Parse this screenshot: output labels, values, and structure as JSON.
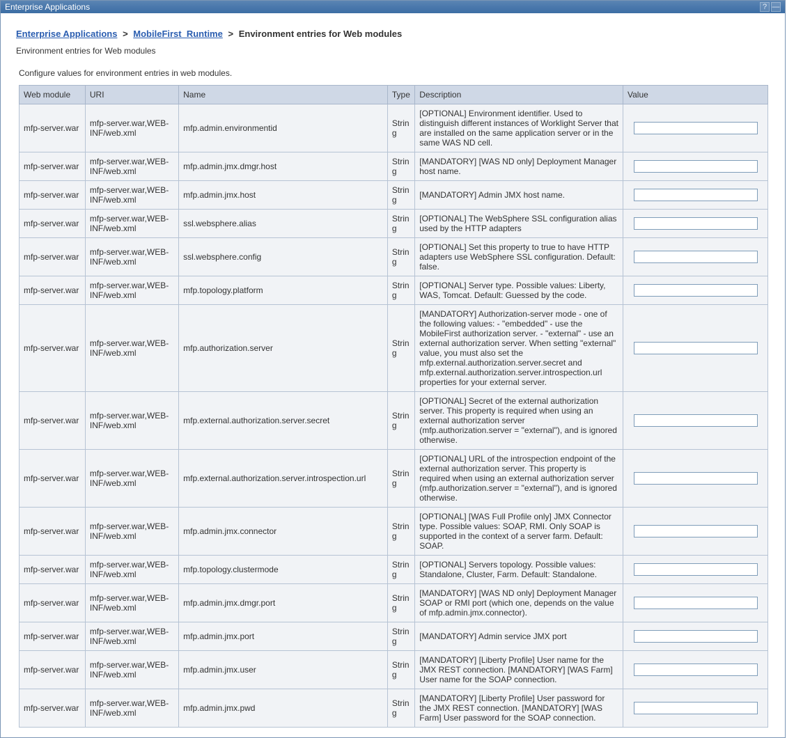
{
  "titlebar": {
    "title": "Enterprise Applications",
    "help_icon": "?",
    "minimize_icon": "—"
  },
  "breadcrumb": {
    "link1": "Enterprise Applications",
    "link2": "MobileFirst_Runtime",
    "current": "Environment entries for Web modules",
    "sep": ">"
  },
  "subtitle": "Environment entries for Web modules",
  "description": "Configure values for environment entries in web modules.",
  "columns": {
    "web_module": "Web module",
    "uri": "URI",
    "name": "Name",
    "type": "Type",
    "description": "Description",
    "value": "Value"
  },
  "rows": [
    {
      "web_module": "mfp-server.war",
      "uri": "mfp-server.war,WEB-INF/web.xml",
      "name": "mfp.admin.environmentid",
      "type": "String",
      "description": "[OPTIONAL] Environment identifier. Used to distinguish different instances of Worklight Server that are installed on the same application server or in the same WAS ND cell.",
      "value": ""
    },
    {
      "web_module": "mfp-server.war",
      "uri": "mfp-server.war,WEB-INF/web.xml",
      "name": "mfp.admin.jmx.dmgr.host",
      "type": "String",
      "description": "[MANDATORY] [WAS ND only] Deployment Manager host name.",
      "value": ""
    },
    {
      "web_module": "mfp-server.war",
      "uri": "mfp-server.war,WEB-INF/web.xml",
      "name": "mfp.admin.jmx.host",
      "type": "String",
      "description": "[MANDATORY] Admin JMX host name.",
      "value": ""
    },
    {
      "web_module": "mfp-server.war",
      "uri": "mfp-server.war,WEB-INF/web.xml",
      "name": "ssl.websphere.alias",
      "type": "String",
      "description": "[OPTIONAL] The WebSphere SSL configuration alias used by the HTTP adapters",
      "value": ""
    },
    {
      "web_module": "mfp-server.war",
      "uri": "mfp-server.war,WEB-INF/web.xml",
      "name": "ssl.websphere.config",
      "type": "String",
      "description": "[OPTIONAL] Set this property to true to have HTTP adapters use WebSphere SSL configuration. Default: false.",
      "value": ""
    },
    {
      "web_module": "mfp-server.war",
      "uri": "mfp-server.war,WEB-INF/web.xml",
      "name": "mfp.topology.platform",
      "type": "String",
      "description": "[OPTIONAL] Server type. Possible values: Liberty, WAS, Tomcat. Default: Guessed by the code.",
      "value": ""
    },
    {
      "web_module": "mfp-server.war",
      "uri": "mfp-server.war,WEB-INF/web.xml",
      "name": "mfp.authorization.server",
      "type": "String",
      "description": "[MANDATORY] Authorization-server mode - one of the following values: - \"embedded\" - use the MobileFirst authorization server. - \"external\" - use an external authorization server. When setting \"external\" value, you must also set the mfp.external.authorization.server.secret and mfp.external.authorization.server.introspection.url properties for your external server.",
      "value": ""
    },
    {
      "web_module": "mfp-server.war",
      "uri": "mfp-server.war,WEB-INF/web.xml",
      "name": "mfp.external.authorization.server.secret",
      "type": "String",
      "description": "[OPTIONAL] Secret of the external authorization server. This property is required when using an external authorization server (mfp.authorization.server = \"external\"), and is ignored otherwise.",
      "value": ""
    },
    {
      "web_module": "mfp-server.war",
      "uri": "mfp-server.war,WEB-INF/web.xml",
      "name": "mfp.external.authorization.server.introspection.url",
      "type": "String",
      "description": "[OPTIONAL] URL of the introspection endpoint of the external authorization server. This property is required when using an external authorization server (mfp.authorization.server = \"external\"), and is ignored otherwise.",
      "value": ""
    },
    {
      "web_module": "mfp-server.war",
      "uri": "mfp-server.war,WEB-INF/web.xml",
      "name": "mfp.admin.jmx.connector",
      "type": "String",
      "description": "[OPTIONAL] [WAS Full Profile only] JMX Connector type. Possible values: SOAP, RMI. Only SOAP is supported in the context of a server farm. Default: SOAP.",
      "value": ""
    },
    {
      "web_module": "mfp-server.war",
      "uri": "mfp-server.war,WEB-INF/web.xml",
      "name": "mfp.topology.clustermode",
      "type": "String",
      "description": "[OPTIONAL] Servers topology. Possible values: Standalone, Cluster, Farm. Default: Standalone.",
      "value": ""
    },
    {
      "web_module": "mfp-server.war",
      "uri": "mfp-server.war,WEB-INF/web.xml",
      "name": "mfp.admin.jmx.dmgr.port",
      "type": "String",
      "description": "[MANDATORY] [WAS ND only] Deployment Manager SOAP or RMI port (which one, depends on the value of mfp.admin.jmx.connector).",
      "value": ""
    },
    {
      "web_module": "mfp-server.war",
      "uri": "mfp-server.war,WEB-INF/web.xml",
      "name": "mfp.admin.jmx.port",
      "type": "String",
      "description": "[MANDATORY] Admin service JMX port",
      "value": ""
    },
    {
      "web_module": "mfp-server.war",
      "uri": "mfp-server.war,WEB-INF/web.xml",
      "name": "mfp.admin.jmx.user",
      "type": "String",
      "description": "[MANDATORY] [Liberty Profile] User name for the JMX REST connection. [MANDATORY] [WAS Farm] User name for the SOAP connection.",
      "value": ""
    },
    {
      "web_module": "mfp-server.war",
      "uri": "mfp-server.war,WEB-INF/web.xml",
      "name": "mfp.admin.jmx.pwd",
      "type": "String",
      "description": "[MANDATORY] [Liberty Profile] User password for the JMX REST connection. [MANDATORY] [WAS Farm] User password for the SOAP connection.",
      "value": ""
    }
  ]
}
